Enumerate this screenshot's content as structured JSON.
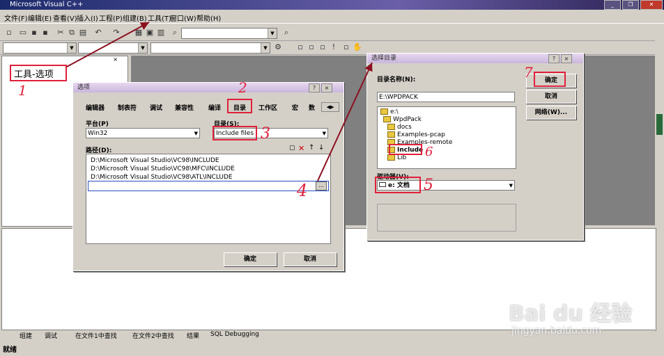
{
  "window": {
    "title": "Microsoft Visual C++"
  },
  "menubar": {
    "items": [
      "文件(F)",
      "编辑(E)",
      "查看(V)",
      "插入(I)",
      "工程(P)",
      "组建(B)",
      "工具(T)",
      "窗口(W)",
      "帮助(H)"
    ]
  },
  "annotation": {
    "label_tools": "工具-选项",
    "n1": "1",
    "n2": "2",
    "n3": "3",
    "n4": "4",
    "n5": "5",
    "n6": "6",
    "n7": "7"
  },
  "options_dialog": {
    "title": "选项",
    "help": "?",
    "close": "×",
    "tabs": [
      "编辑器",
      "制表符",
      "调试",
      "兼容性",
      "编译",
      "目录",
      "工作区",
      "宏",
      "数"
    ],
    "platform_label": "平台(P)",
    "platform_value": "Win32",
    "dirs_label": "目录(S):",
    "dirs_value": "Include files",
    "path_label": "路径(D):",
    "paths": [
      "D:\\Microsoft Visual Studio\\VC98\\INCLUDE",
      "D:\\Microsoft Visual Studio\\VC98\\MFC\\INCLUDE",
      "D:\\Microsoft Visual Studio\\VC98\\ATL\\INCLUDE"
    ],
    "browse": "...",
    "ok": "确定",
    "cancel": "取消"
  },
  "choose_dialog": {
    "title": "选择目录",
    "help": "?",
    "close": "×",
    "dirname_label": "目录名称(N):",
    "dirname_value": "E:\\WPDPACK",
    "tree": [
      "e:\\",
      "WpdPack",
      "docs",
      "Examples-pcap",
      "Examples-remote",
      "Include",
      "Lib"
    ],
    "drive_label": "驱动器(V):",
    "drive_value": "e: 文档",
    "ok": "确定",
    "cancel": "取消",
    "network": "网络(W)..."
  },
  "bottom_tabs": [
    "组建",
    "调试",
    "在文件1中查找",
    "在文件2中查找",
    "结果",
    "SQL Debugging"
  ],
  "status": {
    "text": "就绪"
  },
  "watermark": {
    "text": "Bai du 经验",
    "url": "jingyan.baidu.com"
  }
}
